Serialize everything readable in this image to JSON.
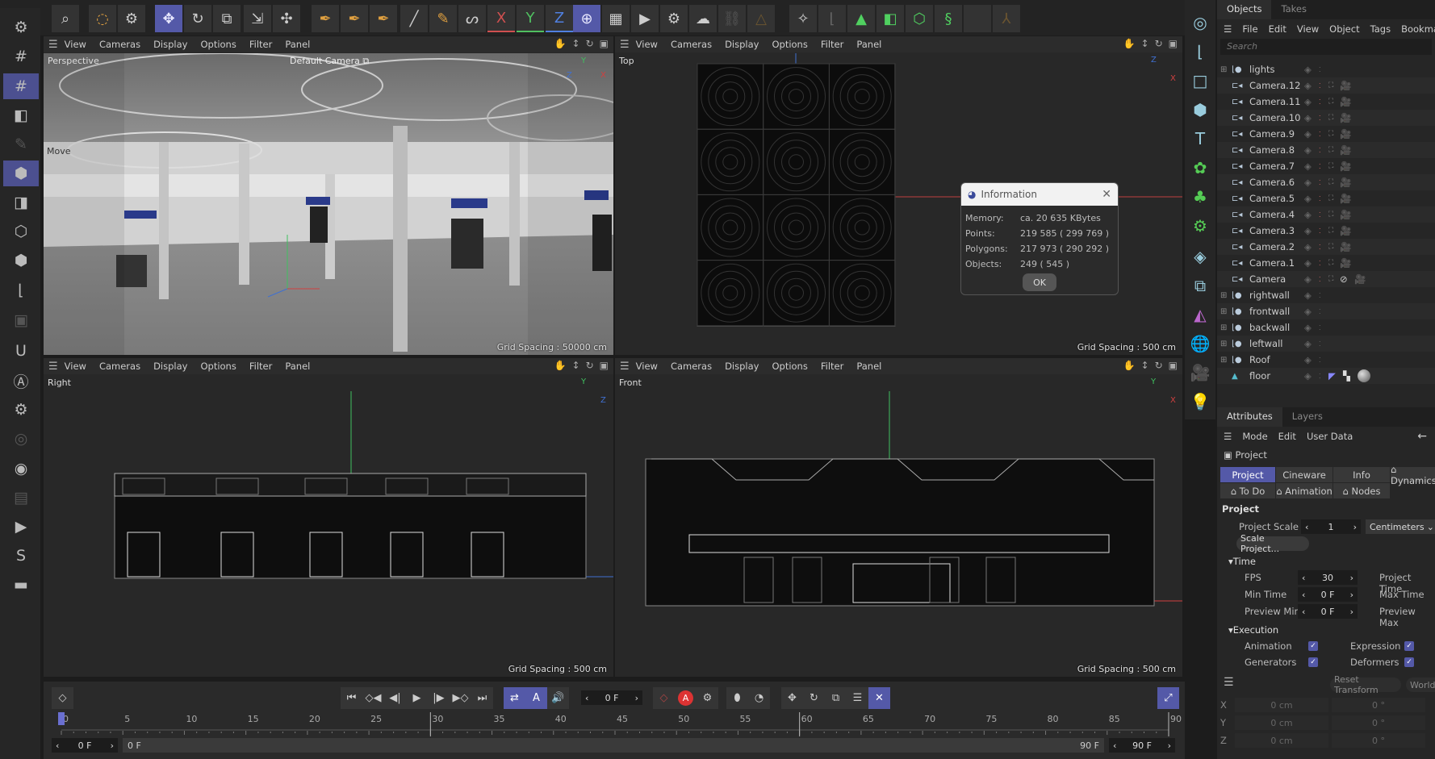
{
  "toolbar": {
    "axis_x": "X",
    "axis_y": "Y",
    "axis_z": "Z"
  },
  "viewport_menu": [
    "View",
    "Cameras",
    "Display",
    "Options",
    "Filter",
    "Panel"
  ],
  "viewports": {
    "perspective": {
      "label": "Perspective",
      "camera": "Default Camera",
      "tool": "Move",
      "grid": "Grid Spacing : 50000 cm",
      "axis_y": "Y",
      "axis_z": "Z",
      "axis_x": "X"
    },
    "top": {
      "label": "Top",
      "grid": "Grid Spacing : 500 cm",
      "axis_z": "Z",
      "axis_x": "X"
    },
    "right": {
      "label": "Right",
      "grid": "Grid Spacing : 500 cm",
      "axis_y": "Y",
      "axis_z": "Z"
    },
    "front": {
      "label": "Front",
      "grid": "Grid Spacing : 500 cm",
      "axis_y": "Y",
      "axis_x": "X"
    }
  },
  "info_dialog": {
    "title": "Information",
    "rows": [
      {
        "label": "Memory:",
        "value": "ca. 20 635 KBytes"
      },
      {
        "label": "Points:",
        "value": "219 585 ( 299 769 )"
      },
      {
        "label": "Polygons:",
        "value": "217 973 ( 290 292 )"
      },
      {
        "label": "Objects:",
        "value": "249 ( 545 )"
      }
    ],
    "ok": "OK"
  },
  "objects_panel": {
    "tabs": [
      "Objects",
      "Takes"
    ],
    "menu": [
      "File",
      "Edit",
      "View",
      "Object",
      "Tags",
      "Bookmarks"
    ],
    "search_placeholder": "Search",
    "items": [
      {
        "name": "lights",
        "type": "null"
      },
      {
        "name": "Camera.12",
        "type": "camera"
      },
      {
        "name": "Camera.11",
        "type": "camera"
      },
      {
        "name": "Camera.10",
        "type": "camera"
      },
      {
        "name": "Camera.9",
        "type": "camera"
      },
      {
        "name": "Camera.8",
        "type": "camera"
      },
      {
        "name": "Camera.7",
        "type": "camera"
      },
      {
        "name": "Camera.6",
        "type": "camera"
      },
      {
        "name": "Camera.5",
        "type": "camera"
      },
      {
        "name": "Camera.4",
        "type": "camera"
      },
      {
        "name": "Camera.3",
        "type": "camera"
      },
      {
        "name": "Camera.2",
        "type": "camera"
      },
      {
        "name": "Camera.1",
        "type": "camera"
      },
      {
        "name": "Camera",
        "type": "camera"
      },
      {
        "name": "rightwall",
        "type": "null"
      },
      {
        "name": "frontwall",
        "type": "null"
      },
      {
        "name": "backwall",
        "type": "null"
      },
      {
        "name": "leftwall",
        "type": "null"
      },
      {
        "name": "Roof",
        "type": "null"
      },
      {
        "name": "floor",
        "type": "floor"
      }
    ]
  },
  "attributes": {
    "tabs": [
      "Attributes",
      "Layers"
    ],
    "menu": [
      "Mode",
      "Edit",
      "User Data"
    ],
    "object": "Project",
    "ptabs": [
      "Project",
      "Cineware",
      "Info",
      "⌂ Dynamics",
      "⌂ To Do",
      "⌂ Animation",
      "⌂ Nodes"
    ],
    "section": "Project",
    "scale_label": "Project Scale",
    "scale_value": "1",
    "scale_unit": "Centimeters",
    "scale_button": "Scale Project...",
    "time_group": "Time",
    "fps_label": "FPS",
    "fps": "30",
    "min_time_label": "Min Time",
    "min_time": "0 F",
    "preview_min_label": "Preview Min",
    "preview_min": "0 F",
    "project_time_label": "Project Time",
    "max_time_label": "Max Time",
    "preview_max_label": "Preview Max",
    "exec_group": "Execution",
    "animation_label": "Animation",
    "expression_label": "Expression",
    "generators_label": "Generators",
    "deformers_label": "Deformers"
  },
  "coordinates": {
    "reset": "Reset Transform",
    "world": "World",
    "rows": [
      {
        "axis": "X",
        "pos": "0 cm",
        "rot": "0 °"
      },
      {
        "axis": "Y",
        "pos": "0 cm",
        "rot": "0 °"
      },
      {
        "axis": "Z",
        "pos": "0 cm",
        "rot": "0 °"
      }
    ]
  },
  "timeline": {
    "current_frame": "0 F",
    "ruler": [
      "0",
      "5",
      "10",
      "15",
      "20",
      "25",
      "30",
      "35",
      "40",
      "45",
      "50",
      "55",
      "60",
      "65",
      "70",
      "75",
      "80",
      "85",
      "90"
    ],
    "start": "0 F",
    "range_start": "0 F",
    "range_end": "90 F",
    "end": "90 F",
    "playhead_frame": 0,
    "max_frame": 90
  },
  "colors": {
    "accent": "#5459a8",
    "camera_tag": "#e87a2a",
    "axis_x": "#d04040",
    "axis_y": "#40c060",
    "axis_z": "#4070d0"
  }
}
